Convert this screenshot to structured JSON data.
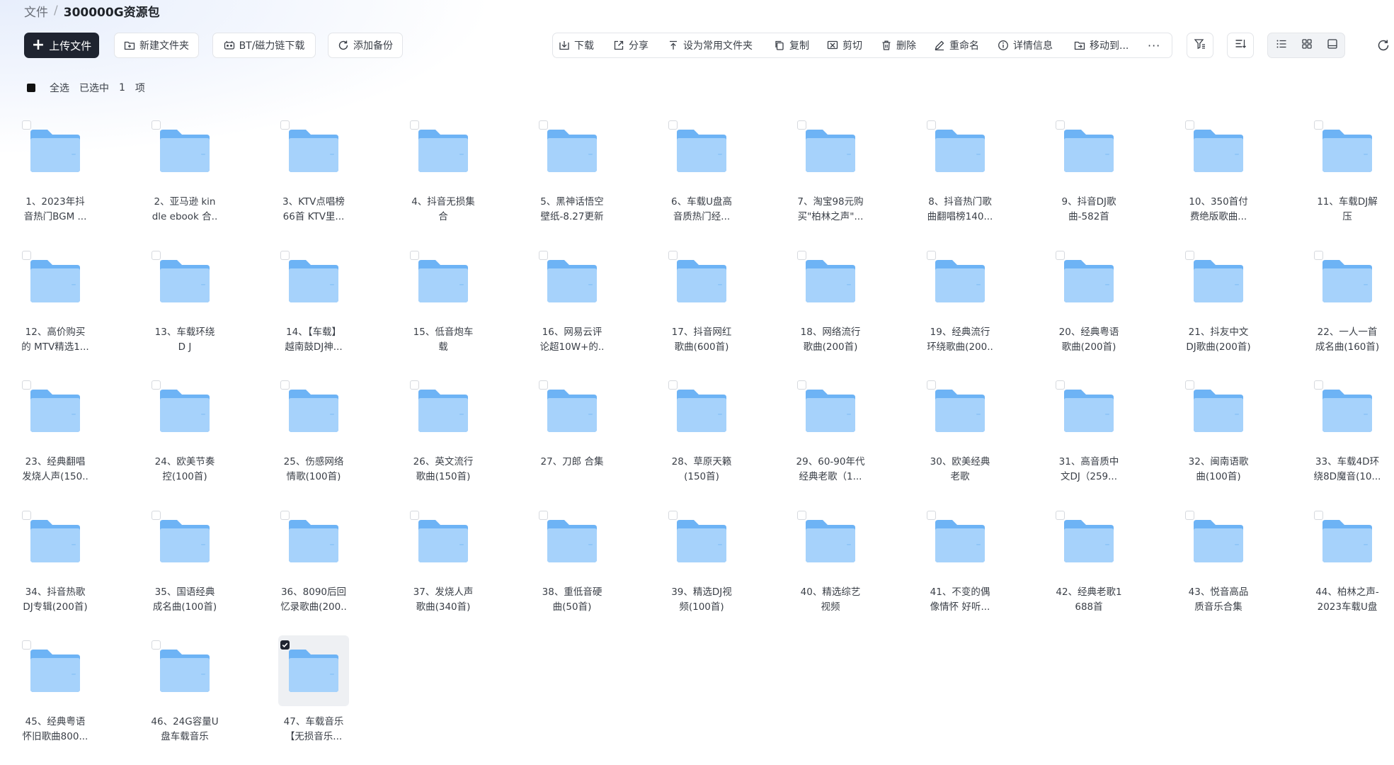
{
  "breadcrumb": {
    "root": "文件",
    "separator": "/",
    "current": "300000G资源包"
  },
  "toolbar": {
    "upload": "上传文件",
    "new_folder": "新建文件夹",
    "bt_download": "BT/磁力链下载",
    "add_backup": "添加备份",
    "actions": [
      {
        "label": "下载",
        "icon": "download-icon"
      },
      {
        "label": "分享",
        "icon": "share-icon"
      },
      {
        "label": "设为常用文件夹",
        "icon": "pin-icon"
      },
      {
        "label": "复制",
        "icon": "copy-icon"
      },
      {
        "label": "剪切",
        "icon": "cut-icon"
      },
      {
        "label": "删除",
        "icon": "trash-icon"
      },
      {
        "label": "重命名",
        "icon": "pencil-icon"
      },
      {
        "label": "详情信息",
        "icon": "info-icon"
      },
      {
        "label": "移动到...",
        "icon": "move-icon"
      }
    ],
    "more": "···",
    "view_modes": [
      "list-view-icon",
      "grid-view-icon",
      "large-view-icon"
    ],
    "active_view": "grid-view-icon"
  },
  "selection": {
    "select_all": "全选",
    "selected_prefix": "已选中",
    "selected_count": "1",
    "selected_suffix": "项"
  },
  "colors": {
    "primary_button": "#1f2430",
    "folder_light": "#a6d2fb",
    "folder_dark": "#6db3f5"
  },
  "folders": [
    {
      "line1": "1、2023年抖",
      "line2": "音热门BGM ..."
    },
    {
      "line1": "2、亚马逊 kin",
      "line2": "dle ebook 合.."
    },
    {
      "line1": "3、KTV点唱榜",
      "line2": "66首 KTV里..."
    },
    {
      "line1": "4、抖音无损集",
      "line2": "合"
    },
    {
      "line1": "5、黑神话悟空",
      "line2": "壁纸-8.27更新"
    },
    {
      "line1": "6、车载U盘高",
      "line2": "音质热门经..."
    },
    {
      "line1": "7、淘宝98元购",
      "line2": "买\"柏林之声\"..."
    },
    {
      "line1": "8、抖音热门歌",
      "line2": "曲翻唱榜140..."
    },
    {
      "line1": "9、抖音DJ歌",
      "line2": "曲-582首"
    },
    {
      "line1": "10、350首付",
      "line2": "费绝版歌曲..."
    },
    {
      "line1": "11、车载DJ解",
      "line2": "压"
    },
    {
      "line1": "12、高价购买",
      "line2": "的 MTV精选1..."
    },
    {
      "line1": "13、车载环绕",
      "line2": "D J"
    },
    {
      "line1": "14、【车载】",
      "line2": "越南鼓DJ神..."
    },
    {
      "line1": "15、低音炮车",
      "line2": "载"
    },
    {
      "line1": "16、网易云评",
      "line2": "论超10W+的.."
    },
    {
      "line1": "17、抖音网红",
      "line2": "歌曲(600首)"
    },
    {
      "line1": "18、网络流行",
      "line2": "歌曲(200首)"
    },
    {
      "line1": "19、经典流行",
      "line2": "环绕歌曲(200.."
    },
    {
      "line1": "20、经典粤语",
      "line2": "歌曲(200首)"
    },
    {
      "line1": "21、抖友中文",
      "line2": "DJ歌曲(200首)"
    },
    {
      "line1": "22、一人一首",
      "line2": "成名曲(160首)"
    },
    {
      "line1": "23、经典翻唱",
      "line2": "发烧人声(150.."
    },
    {
      "line1": "24、欧美节奏",
      "line2": "控(100首)"
    },
    {
      "line1": "25、伤感网络",
      "line2": "情歌(100首)"
    },
    {
      "line1": "26、英文流行",
      "line2": "歌曲(150首)"
    },
    {
      "line1": "27、刀郎 合集",
      "line2": ""
    },
    {
      "line1": "28、草原天籁",
      "line2": "(150首)"
    },
    {
      "line1": "29、60-90年代",
      "line2": "经典老歌（1..."
    },
    {
      "line1": "30、欧美经典",
      "line2": "老歌"
    },
    {
      "line1": "31、高音质中",
      "line2": "文DJ（259..."
    },
    {
      "line1": "32、闽南语歌",
      "line2": "曲(100首)"
    },
    {
      "line1": "33、车载4D环",
      "line2": "绕8D魔音(10..."
    },
    {
      "line1": "34、抖音热歌",
      "line2": "DJ专辑(200首)"
    },
    {
      "line1": "35、国语经典",
      "line2": "成名曲(100首)"
    },
    {
      "line1": "36、8090后回",
      "line2": "忆录歌曲(200.."
    },
    {
      "line1": "37、发烧人声",
      "line2": "歌曲(340首)"
    },
    {
      "line1": "38、重低音硬",
      "line2": "曲(50首)"
    },
    {
      "line1": "39、精选DJ视",
      "line2": "频(100首)"
    },
    {
      "line1": "40、精选综艺",
      "line2": "视频"
    },
    {
      "line1": "41、不变的偶",
      "line2": "像情怀 好听..."
    },
    {
      "line1": "42、经典老歌1",
      "line2": "688首"
    },
    {
      "line1": "43、悦音高品",
      "line2": "质音乐合集"
    },
    {
      "line1": "44、柏林之声-",
      "line2": "2023车载U盘"
    },
    {
      "line1": "45、经典粤语",
      "line2": "怀旧歌曲800..."
    },
    {
      "line1": "46、24G容量U",
      "line2": "盘车载音乐"
    },
    {
      "line1": "47、车载音乐",
      "line2": "【无损音乐...",
      "selected": true
    }
  ]
}
